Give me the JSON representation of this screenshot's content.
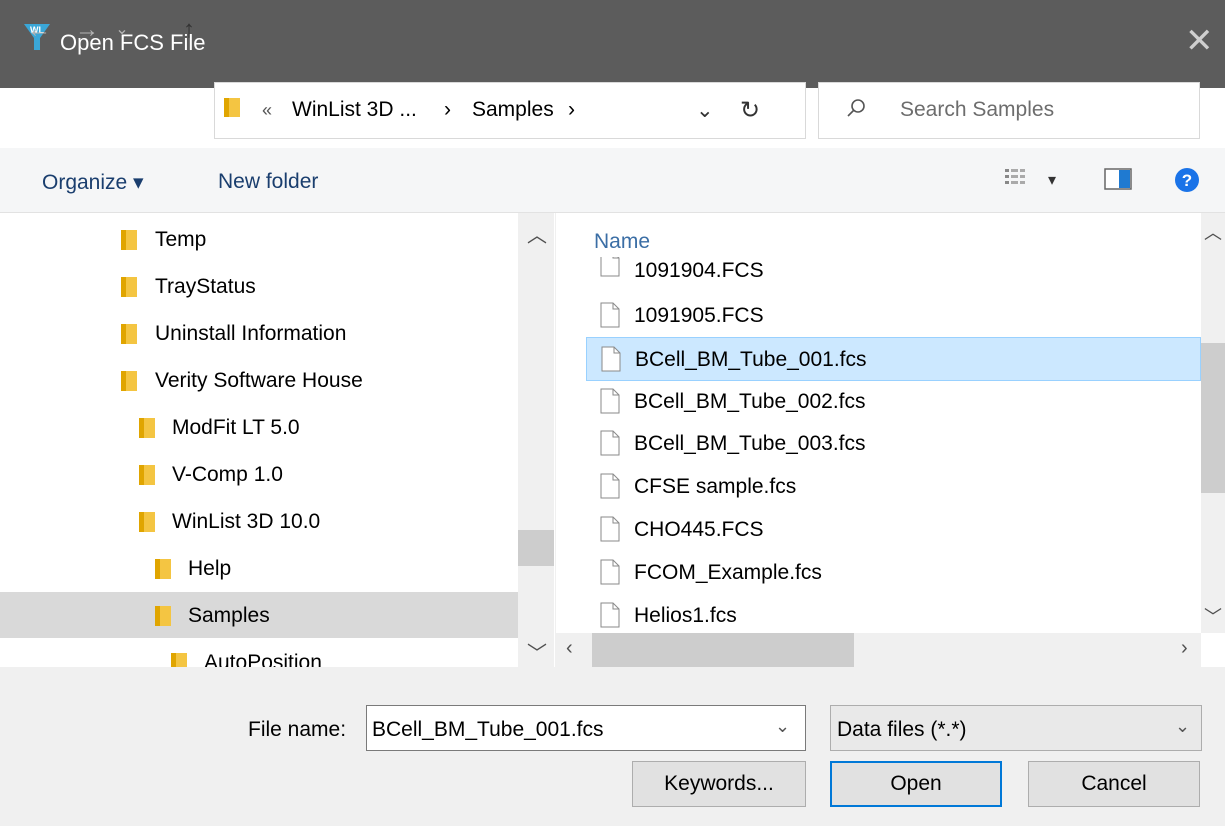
{
  "window": {
    "title": "Open FCS File",
    "app_icon_text": "WL"
  },
  "nav": {
    "back": "←",
    "forward": "→",
    "recent": "⌄",
    "up": "↑",
    "breadcrumb": [
      "«",
      "WinList 3D ...",
      "›",
      "Samples",
      "›"
    ],
    "dropdown": "⌄",
    "refresh": "↻",
    "search_placeholder": "Search Samples"
  },
  "toolbar": {
    "organize": "Organize ▾",
    "new_folder": "New folder",
    "view_dropdown": "▾",
    "help": "?"
  },
  "tree": [
    {
      "label": "Temp"
    },
    {
      "label": "TrayStatus"
    },
    {
      "label": "Uninstall Information"
    },
    {
      "label": "Verity Software House"
    },
    {
      "label": "ModFit LT 5.0"
    },
    {
      "label": "V-Comp 1.0"
    },
    {
      "label": "WinList 3D 10.0"
    },
    {
      "label": "Help"
    },
    {
      "label": "Samples",
      "selected": true
    },
    {
      "label": "AutoPosition"
    }
  ],
  "files": {
    "column_header": "Name",
    "items": [
      {
        "name": "1091904.FCS"
      },
      {
        "name": "1091905.FCS"
      },
      {
        "name": "BCell_BM_Tube_001.fcs",
        "selected": true
      },
      {
        "name": "BCell_BM_Tube_002.fcs"
      },
      {
        "name": "BCell_BM_Tube_003.fcs"
      },
      {
        "name": "CFSE sample.fcs"
      },
      {
        "name": "CHO445.FCS"
      },
      {
        "name": "FCOM_Example.fcs"
      },
      {
        "name": "Helios1.fcs"
      }
    ]
  },
  "bottom": {
    "file_name_label": "File name:",
    "file_name_value": "BCell_BM_Tube_001.fcs",
    "file_type_value": "Data files (*.*)",
    "keywords_button": "Keywords...",
    "open_button": "Open",
    "cancel_button": "Cancel"
  },
  "colors": {
    "titlebar": "#5c5c5c",
    "selection": "#cce8ff",
    "accent": "#0078d7"
  }
}
